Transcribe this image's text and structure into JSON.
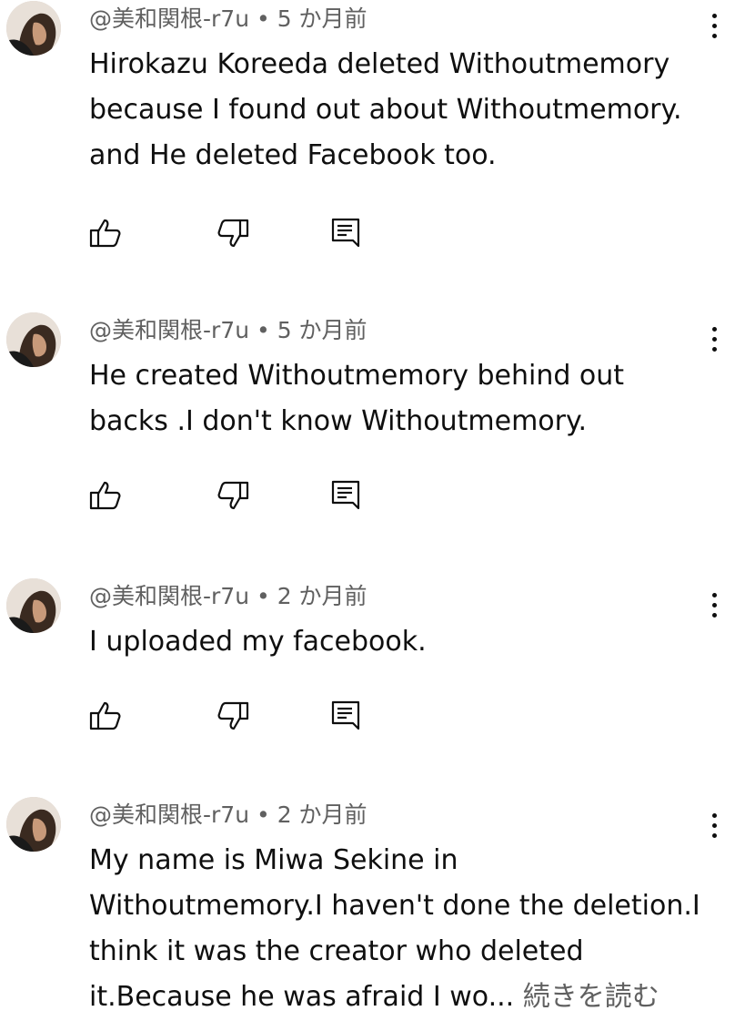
{
  "comments": [
    {
      "author": "@美和関根-r7u",
      "separator": " • ",
      "time": "5 か月前",
      "lines": [
        "Hirokazu Koreeda deleted Withoutmemory",
        "because I found out about Withoutmemory.",
        "and He deleted Facebook too."
      ]
    },
    {
      "author": "@美和関根-r7u",
      "separator": " • ",
      "time": "5 か月前",
      "lines": [
        "He created Withoutmemory behind out",
        "backs .I don't know Withoutmemory."
      ]
    },
    {
      "author": "@美和関根-r7u",
      "separator": " • ",
      "time": "2 か月前",
      "lines": [
        "I uploaded my facebook."
      ]
    },
    {
      "author": "@美和関根-r7u",
      "separator": " • ",
      "time": "2 か月前",
      "lines": [
        "My name is Miwa Sekine in",
        "Withoutmemory.I haven't done the deletion.I",
        "think it was the creator who deleted",
        "it.Because he was afraid I wo... "
      ],
      "read_more": "続きを読む"
    }
  ],
  "icons": {
    "like": "thumbs-up-icon",
    "dislike": "thumbs-down-icon",
    "reply": "reply-comment-icon",
    "more": "more-vert-icon"
  }
}
